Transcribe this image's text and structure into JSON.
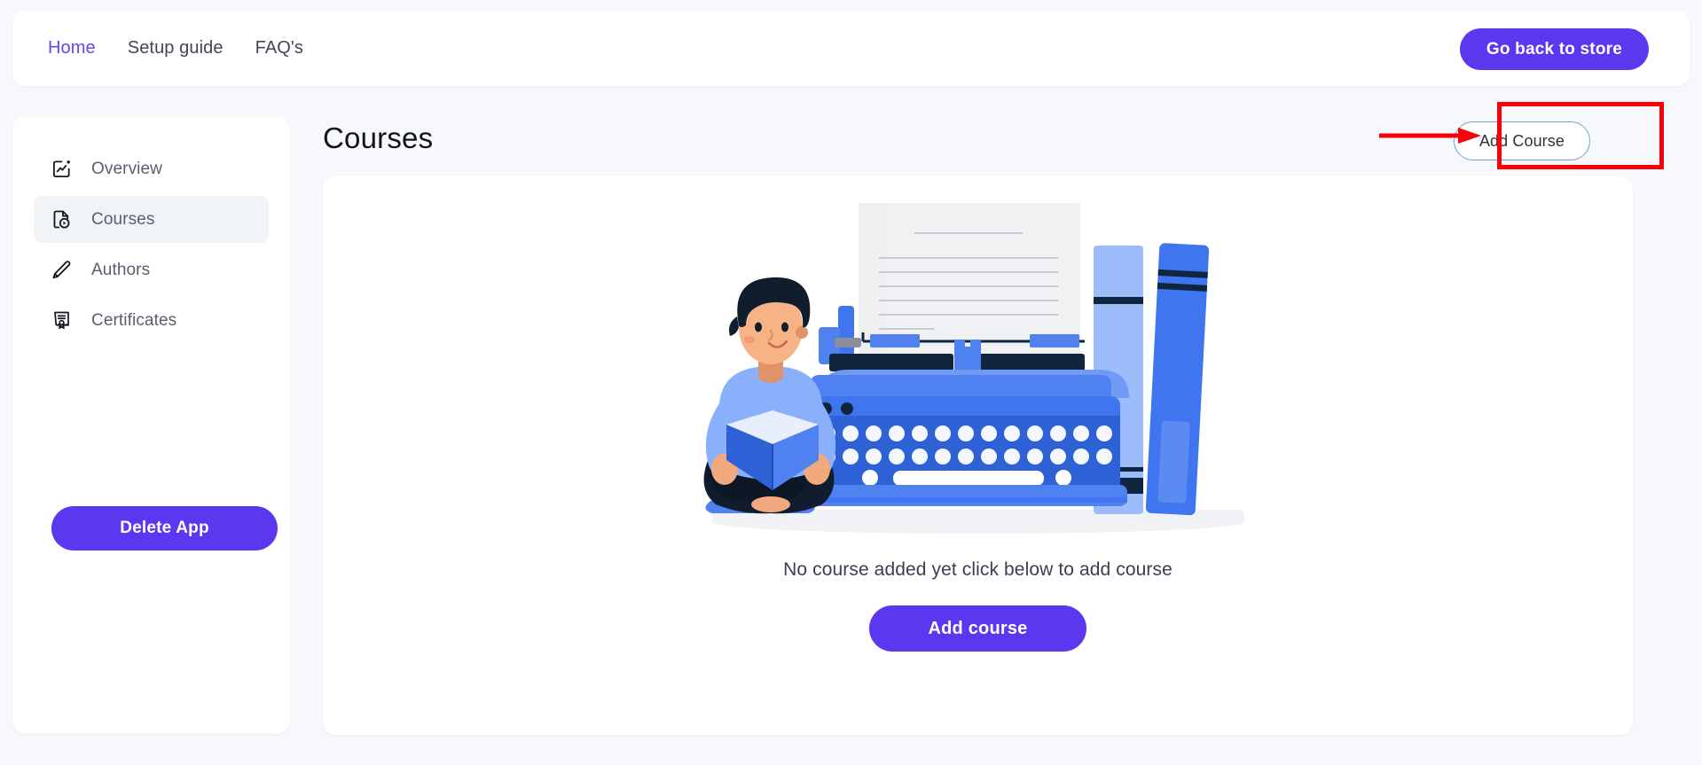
{
  "header": {
    "nav": [
      {
        "label": "Home",
        "active": true
      },
      {
        "label": "Setup guide",
        "active": false
      },
      {
        "label": "FAQ's",
        "active": false
      }
    ],
    "store_button": "Go back to store"
  },
  "sidebar": {
    "items": [
      {
        "label": "Overview",
        "icon": "overview-chart-icon",
        "active": false
      },
      {
        "label": "Courses",
        "icon": "course-file-play-icon",
        "active": true
      },
      {
        "label": "Authors",
        "icon": "pencil-icon",
        "active": false
      },
      {
        "label": "Certificates",
        "icon": "certificate-icon",
        "active": false
      }
    ],
    "delete_button": "Delete App"
  },
  "main": {
    "title": "Courses",
    "add_course_outline_button": "Add Course",
    "empty_state_text": "No course added yet click below to add course",
    "add_course_solid_button": "Add course",
    "illustration_name": "person-reading-beside-typewriter-and-books"
  },
  "annotations": {
    "highlight_box_target": "Add Course",
    "arrow_direction": "right",
    "color": "#fb0007"
  },
  "colors": {
    "brand_purple": "#5b37f0",
    "nav_active": "#6247f5",
    "page_background": "#f7f8fc",
    "card_background": "#ffffff",
    "sidebar_active_background": "#f1f4f7",
    "outline_button_border": "#6fa0d8",
    "annotation_red": "#fb0007"
  }
}
